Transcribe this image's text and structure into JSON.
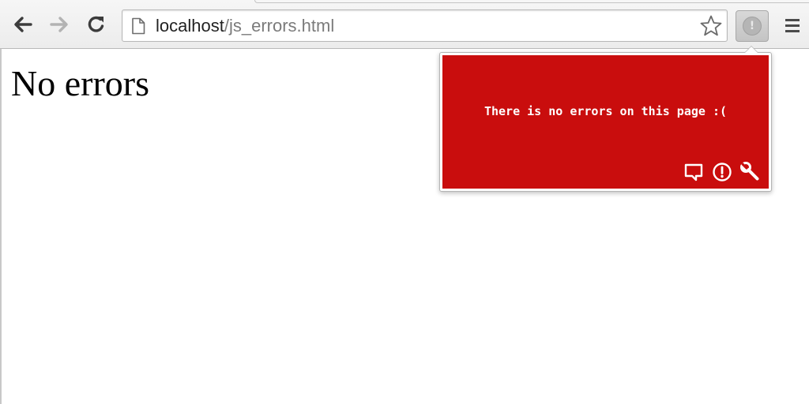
{
  "browser": {
    "address_bar": {
      "host": "localhost",
      "path": "/js_errors.html"
    },
    "icons": {
      "back": "back-arrow-icon",
      "forward": "forward-arrow-icon",
      "reload": "reload-icon",
      "page": "page-icon",
      "bookmark": "star-icon",
      "extension": "extension-icon",
      "menu": "hamburger-menu-icon"
    },
    "extension_badge": "!"
  },
  "page": {
    "heading": "No errors"
  },
  "popup": {
    "message": "There is no errors on this page :(",
    "background_color": "#c90d0d",
    "actions": [
      "comment-icon",
      "alert-icon",
      "wrench-icon"
    ]
  }
}
